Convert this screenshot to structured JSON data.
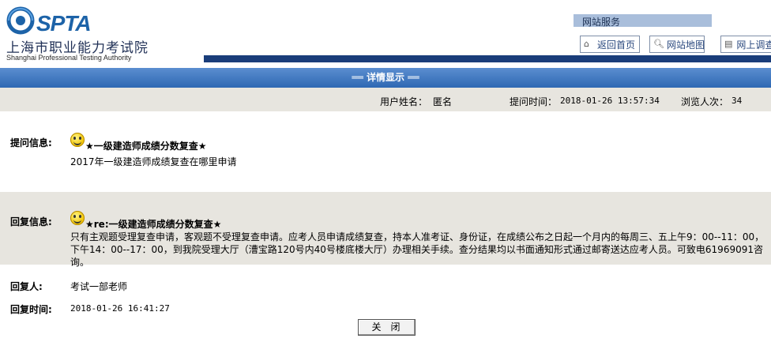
{
  "header": {
    "logo_brand": "SPTA",
    "logo_cn": "上海市职业能力考试院",
    "logo_en": "Shanghai Professional Testing Authority",
    "service_label": "网站服务",
    "nav": [
      {
        "label": "返回首页",
        "icon": "home-icon"
      },
      {
        "label": "网站地图",
        "icon": "search-icon"
      },
      {
        "label": "网上调查",
        "icon": "document-icon"
      }
    ]
  },
  "page_title": "══ 详情显示 ══",
  "meta": {
    "user_label": "用户姓名：",
    "user_value": "匿名",
    "time_label": "提问时间：",
    "time_value": "2018-01-26 13:57:34",
    "views_label": "浏览人次：",
    "views_value": "34"
  },
  "question": {
    "label": "提问信息:",
    "title": "★一级建造师成绩分数复查★",
    "body": "2017年一级建造师成绩复查在哪里申请"
  },
  "answer": {
    "label": "回复信息:",
    "title": "★re:一级建造师成绩分数复查★",
    "body": "只有主观题受理复查申请，客观题不受理复查申请。应考人员申请成绩复查，持本人准考证、身份证，在成绩公布之日起一个月内的每周三、五上午9：00--11：00，下午14：00--17：00，到我院受理大厅（漕宝路120号内40号楼底楼大厅）办理相关手续。查分结果均以书面通知形式通过邮寄送达应考人员。可致电61969091咨询。"
  },
  "reply": {
    "replier_label": "回复人:",
    "replier_value": "考试一部老师",
    "time_label": "回复时间:",
    "time_value": "2018-01-26 16:41:27"
  },
  "close_button": "关闭",
  "colors": {
    "title_bar": "#3b75bf",
    "header_strip": "#1a3d7a",
    "service_bar": "#a9bedb",
    "gray_band": "#e7e5df"
  }
}
